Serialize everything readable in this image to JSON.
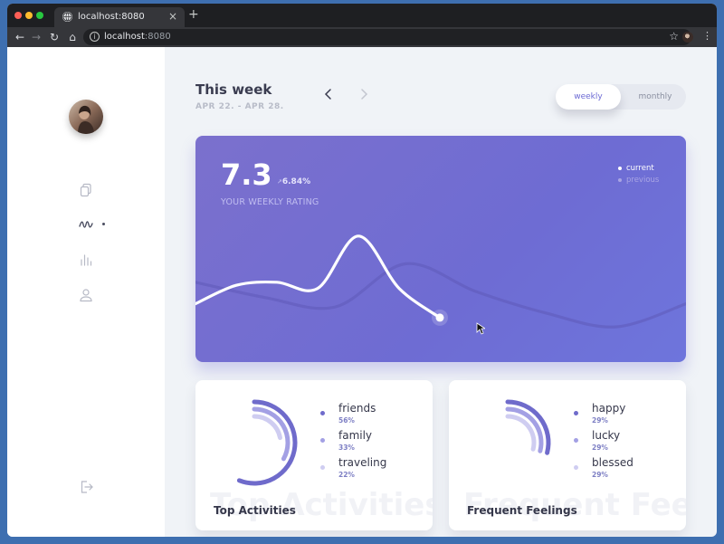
{
  "browser": {
    "tab_title": "localhost:8080",
    "new_tab_icon": "plus-icon",
    "address_host": "localhost",
    "address_port": ":8080"
  },
  "header": {
    "title": "This week",
    "date_range": "APR 22. - APR 28.",
    "toggle": {
      "options": [
        "weekly",
        "monthly"
      ],
      "selected": "weekly"
    }
  },
  "sidebar": {
    "icons": [
      "documents-icon",
      "activity-icon",
      "stats-icon",
      "user-icon",
      "logout-icon"
    ],
    "active": "activity-icon"
  },
  "rating": {
    "value": "7.3",
    "change": "6.84%",
    "label": "YOUR WEEKLY RATING",
    "legend": [
      "current",
      "previous"
    ]
  },
  "chart_data": {
    "type": "line",
    "series": [
      {
        "name": "current",
        "values": [
          3.2,
          4.4,
          4.6,
          4.2,
          7.6,
          4.2,
          2.3
        ]
      },
      {
        "name": "previous",
        "values": [
          4.6,
          3.6,
          3.0,
          5.8,
          4.0,
          2.6,
          1.7,
          3.2
        ]
      }
    ]
  },
  "top_activities": {
    "title": "Top Activities",
    "items": [
      {
        "name": "friends",
        "pct": "56%",
        "value": 56,
        "color": "#6f6bcb"
      },
      {
        "name": "family",
        "pct": "33%",
        "value": 33,
        "color": "#a3a0e4"
      },
      {
        "name": "traveling",
        "pct": "22%",
        "value": 22,
        "color": "#cfcdf1"
      }
    ]
  },
  "frequent_feelings": {
    "title": "Frequent Feelings",
    "items": [
      {
        "name": "happy",
        "pct": "29%",
        "value": 29,
        "color": "#6f6bcb"
      },
      {
        "name": "lucky",
        "pct": "29%",
        "value": 29,
        "color": "#a3a0e4"
      },
      {
        "name": "blessed",
        "pct": "29%",
        "value": 29,
        "color": "#cfcdf1"
      }
    ]
  },
  "colors": {
    "accent": "#6e6cd3",
    "card_bg": "#ffffff",
    "page_bg": "#f0f3f7"
  }
}
